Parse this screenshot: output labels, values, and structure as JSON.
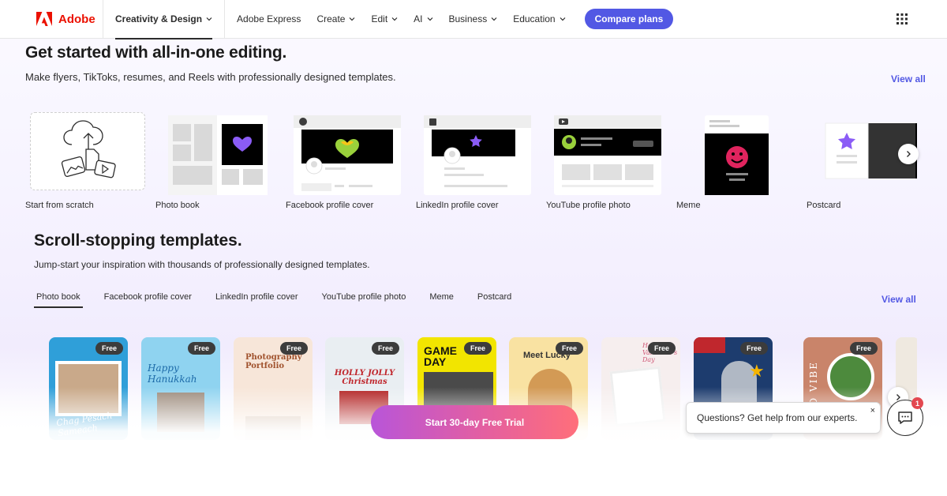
{
  "brand": {
    "name": "Adobe",
    "color": "#eb1000"
  },
  "nav": {
    "creativity": "Creativity & Design",
    "items": [
      "Adobe Express",
      "Create",
      "Edit",
      "AI",
      "Business",
      "Education"
    ],
    "compare": "Compare plans",
    "apps_icon": "apps-grid-icon"
  },
  "section1": {
    "title": "Get started with all-in-one editing.",
    "subtitle": "Make flyers, TikToks, resumes, and Reels with professionally designed templates.",
    "view_all": "View all",
    "cards": [
      "Start from scratch",
      "Photo book",
      "Facebook profile cover",
      "LinkedIn profile cover",
      "YouTube profile photo",
      "Meme",
      "Postcard"
    ]
  },
  "section2": {
    "title": "Scroll-stopping templates.",
    "subtitle": "Jump-start your inspiration with thousands of professionally designed templates.",
    "view_all": "View all",
    "tabs": [
      "Photo book",
      "Facebook profile cover",
      "LinkedIn profile cover",
      "YouTube profile photo",
      "Meme",
      "Postcard"
    ],
    "active_tab": "Photo book",
    "badge": "Free",
    "templates": [
      {
        "text": "Chag Pesach Sameach"
      },
      {
        "text": "Happy Hanukkah"
      },
      {
        "text": "Photography Portfolio"
      },
      {
        "text": "HOLLY JOLLY Christmas"
      },
      {
        "text": "GAME DAY"
      },
      {
        "text": "Meet Lucky"
      },
      {
        "text": "Happy Valentine's Day"
      },
      {
        "text": ""
      },
      {
        "text": "FOOD VIBE"
      }
    ]
  },
  "cta": "Start 30-day Free Trial",
  "help": {
    "text": "Questions? Get help from our experts.",
    "close": "×",
    "badge": "1"
  },
  "colors": {
    "accent": "#5258e4",
    "brand": "#eb1000"
  }
}
